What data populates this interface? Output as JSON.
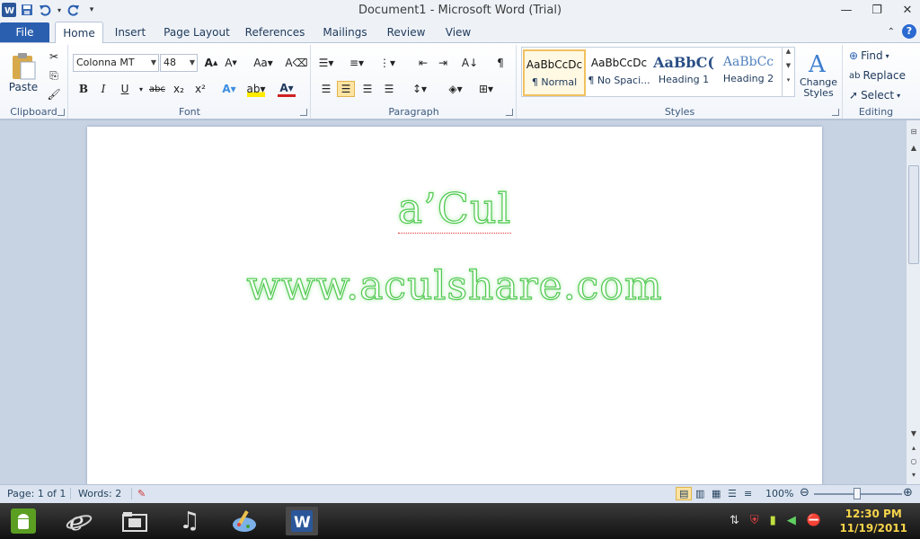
{
  "app": {
    "title": "Document1  -  Microsoft Word (Trial)"
  },
  "tabs": {
    "file": "File",
    "items": [
      "Home",
      "Insert",
      "Page Layout",
      "References",
      "Mailings",
      "Review",
      "View"
    ],
    "active": "Home"
  },
  "ribbon": {
    "clipboard": {
      "label": "Clipboard",
      "paste": "Paste"
    },
    "font": {
      "label": "Font",
      "family": "Colonna MT",
      "size": "48"
    },
    "paragraph": {
      "label": "Paragraph"
    },
    "styles": {
      "label": "Styles",
      "tiles": [
        {
          "sample": "AaBbCcDc",
          "name": "¶ Normal"
        },
        {
          "sample": "AaBbCcDc",
          "name": "¶ No Spaci..."
        },
        {
          "sample": "AaBbC(",
          "name": "Heading 1"
        },
        {
          "sample": "AaBbCc",
          "name": "Heading 2"
        }
      ],
      "change_styles": "Change Styles"
    },
    "editing": {
      "label": "Editing",
      "find": "Find",
      "replace": "Replace",
      "select": "Select"
    }
  },
  "document": {
    "line1": "a’Cul",
    "line2": "www.aculshare.com",
    "text_color": "#4fc94f"
  },
  "statusbar": {
    "page": "Page: 1 of 1",
    "words": "Words: 2",
    "zoom": "100%"
  },
  "taskbar": {
    "time": "12:30 PM",
    "date": "11/19/2011"
  },
  "colors": {
    "file_tab": "#2a5fb0",
    "clock": "#f7d44a"
  }
}
